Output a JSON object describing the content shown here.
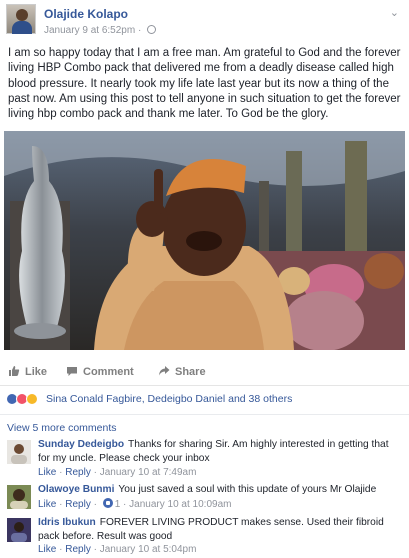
{
  "post": {
    "author": "Olajide Kolapo",
    "timestamp": "January 9 at 6:52pm",
    "separator": " · ",
    "privacy_icon": "globe-icon",
    "menu_icon": "chevron-down-icon",
    "text": "I am so happy today that I am a free man. Am grateful to God and the forever living HBP Combo pack that delivered me from a deadly disease called high blood pressure. It nearly took my life late last year but its now a thing of the past now. Am using this post to tell anyone in such situation to get the forever living hbp combo pack and thank me later. To God be the glory."
  },
  "actions": {
    "like": "Like",
    "comment": "Comment",
    "share": "Share"
  },
  "reactions": {
    "types": [
      "like",
      "love",
      "haha"
    ],
    "colors": {
      "like": "#4267b2",
      "love": "#f25268",
      "haha": "#f7b928"
    },
    "names": "Sina Conald Fagbire, Dedeigbo Daniel and 38 others"
  },
  "comments_section": {
    "view_more": "View 5 more comments",
    "reply_label": "Reply",
    "like_label": "Like",
    "dot": " · ",
    "comments": [
      {
        "name": "Sunday Dedeigbo",
        "text": "Thanks for sharing Sir. Am highly interested in getting that for my uncle. Please check your inbox",
        "time": "January 10 at 7:49am"
      },
      {
        "name": "Olawoye Bunmi",
        "text": "You just saved a soul with this update of yours Mr Olajide",
        "like_count": "1",
        "time": "January 10 at 10:09am"
      },
      {
        "name": "Idris Ibukun",
        "text": "FOREVER LIVING PRODUCT makes sense. Used their fibroid pack before. Result was good",
        "time": "January 10 at 5:04pm"
      }
    ]
  }
}
